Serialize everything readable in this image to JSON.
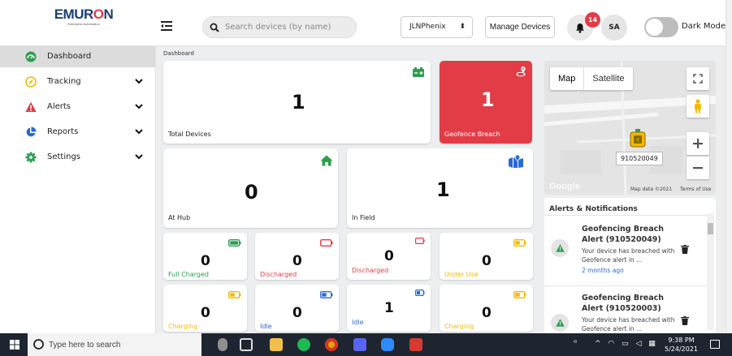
{
  "header": {
    "brand": "EMURON",
    "brand_sub": "Enterprise Automation",
    "search_placeholder": "Search devices (by name)",
    "user_select": "JLNPhenix",
    "manage_label": "Manage Devices",
    "notification_count": "14",
    "avatar_initials": "SA",
    "dark_mode_label": "Dark Mode"
  },
  "sidebar": {
    "items": [
      {
        "label": "Dashboard",
        "icon": "dashboard-icon",
        "color": "#2e9e4f",
        "active": true
      },
      {
        "label": "Tracking",
        "icon": "compass-icon",
        "color": "#f5b800"
      },
      {
        "label": "Alerts",
        "icon": "warning-icon",
        "color": "#e23c46"
      },
      {
        "label": "Reports",
        "icon": "pie-chart-icon",
        "color": "#2b6ad6"
      },
      {
        "label": "Settings",
        "icon": "gear-icon",
        "color": "#2e9e4f"
      }
    ]
  },
  "breadcrumb": "Dashboard",
  "stats": {
    "total_devices": {
      "value": "1",
      "label": "Total Devices"
    },
    "geofence_breach": {
      "value": "1",
      "label": "Geofence Breach"
    },
    "at_hub": {
      "value": "0",
      "label": "At Hub"
    },
    "in_field": {
      "value": "1",
      "label": "In Field"
    }
  },
  "battery": [
    {
      "value": "0",
      "label": "Full Charged",
      "color": "#2e9e4f"
    },
    {
      "value": "0",
      "label": "Discharged",
      "color": "#e23c46"
    },
    {
      "value": "0",
      "label": "Discharged",
      "color": "#e23c46"
    },
    {
      "value": "0",
      "label": "Under Use",
      "color": "#f5b800"
    },
    {
      "value": "0",
      "label": "Charging",
      "color": "#f5b800"
    },
    {
      "value": "0",
      "label": "Idle",
      "color": "#2b6ad6"
    },
    {
      "value": "1",
      "label": "Idle",
      "color": "#2b6ad6"
    },
    {
      "value": "0",
      "label": "Charging",
      "color": "#f5b800"
    }
  ],
  "map": {
    "tab_map": "Map",
    "tab_satellite": "Satellite",
    "marker_label": "910520049",
    "brand": "Google",
    "map_data": "Map data ©2021",
    "terms": "Terms of Use"
  },
  "notifications": {
    "title": "Alerts & Notifications",
    "items": [
      {
        "title": "Geofencing Breach Alert (910520049)",
        "desc": "Your device has breached with Geofence alert in ...",
        "time": "2 months ago"
      },
      {
        "title": "Geofencing Breach Alert (910520003)",
        "desc": "Your device has breached with Geofence alert in ..."
      }
    ]
  },
  "taskbar": {
    "search_placeholder": "Type here to search",
    "time": "9:38 PM",
    "date": "5/24/2021"
  }
}
